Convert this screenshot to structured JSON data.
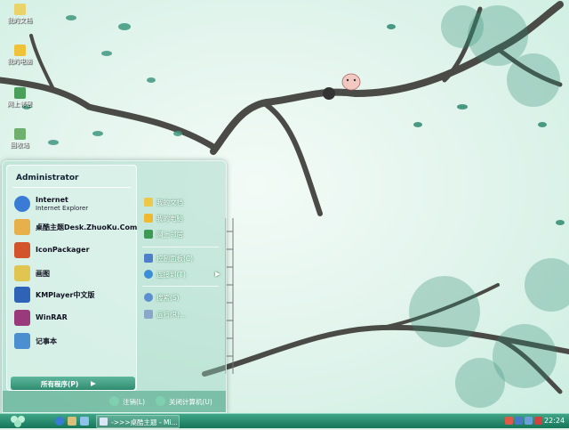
{
  "desktop_icons": [
    {
      "label": "我的文档",
      "color": "#e9d36a"
    },
    {
      "label": "我的电脑",
      "color": "#f0c23a"
    },
    {
      "label": "网上邻居",
      "color": "#4aa05a"
    },
    {
      "label": "回收站",
      "color": "#6fb06f"
    }
  ],
  "start_menu": {
    "user": "Administrator",
    "pinned": [
      {
        "title": "Internet",
        "subtitle": "Internet Explorer",
        "icon": "internet-explorer-icon",
        "color": "#3a7bd5"
      },
      {
        "title": "桌酷主题Desk.ZhuoKu.Com",
        "icon": "zhuoku-icon",
        "color": "#e7b04a"
      },
      {
        "title": "IconPackager",
        "icon": "iconpackager-icon",
        "color": "#d3542a"
      },
      {
        "title": "画图",
        "icon": "paint-icon",
        "color": "#e0c650"
      },
      {
        "title": "KMPlayer中文版",
        "icon": "kmplayer-icon",
        "color": "#2e63b8"
      },
      {
        "title": "WinRAR",
        "icon": "winrar-icon",
        "color": "#9a3a7c"
      },
      {
        "title": "记事本",
        "icon": "notepad-icon",
        "color": "#4b8fd1"
      }
    ],
    "all_programs": "所有程序(P)",
    "all_programs_arrow": "▶",
    "places": [
      {
        "label": "我的文档",
        "icon": "my-documents-icon",
        "color": "#ecc94a"
      },
      {
        "label": "我的电脑",
        "icon": "my-computer-icon",
        "color": "#f0b930"
      },
      {
        "label": "网上邻居",
        "icon": "network-places-icon",
        "color": "#3d9a55"
      }
    ],
    "system": [
      {
        "label": "控制面板(C)",
        "icon": "control-panel-icon",
        "color": "#4f7fc9"
      },
      {
        "label": "连接到(T)",
        "icon": "connect-to-icon",
        "color": "#3a8ed6",
        "arrow": "▶"
      }
    ],
    "actions": [
      {
        "label": "搜索(S)",
        "icon": "search-icon",
        "color": "#5b8fd0"
      },
      {
        "label": "运行(R)...",
        "icon": "run-icon",
        "color": "#8aa6c8"
      }
    ],
    "logoff": "注销(L)",
    "shutdown": "关闭计算机(U)"
  },
  "taskbar": {
    "task_button": "->>>桌酷主题 - Mi...",
    "clock": "22:24",
    "accent": "#1f8a6a"
  }
}
